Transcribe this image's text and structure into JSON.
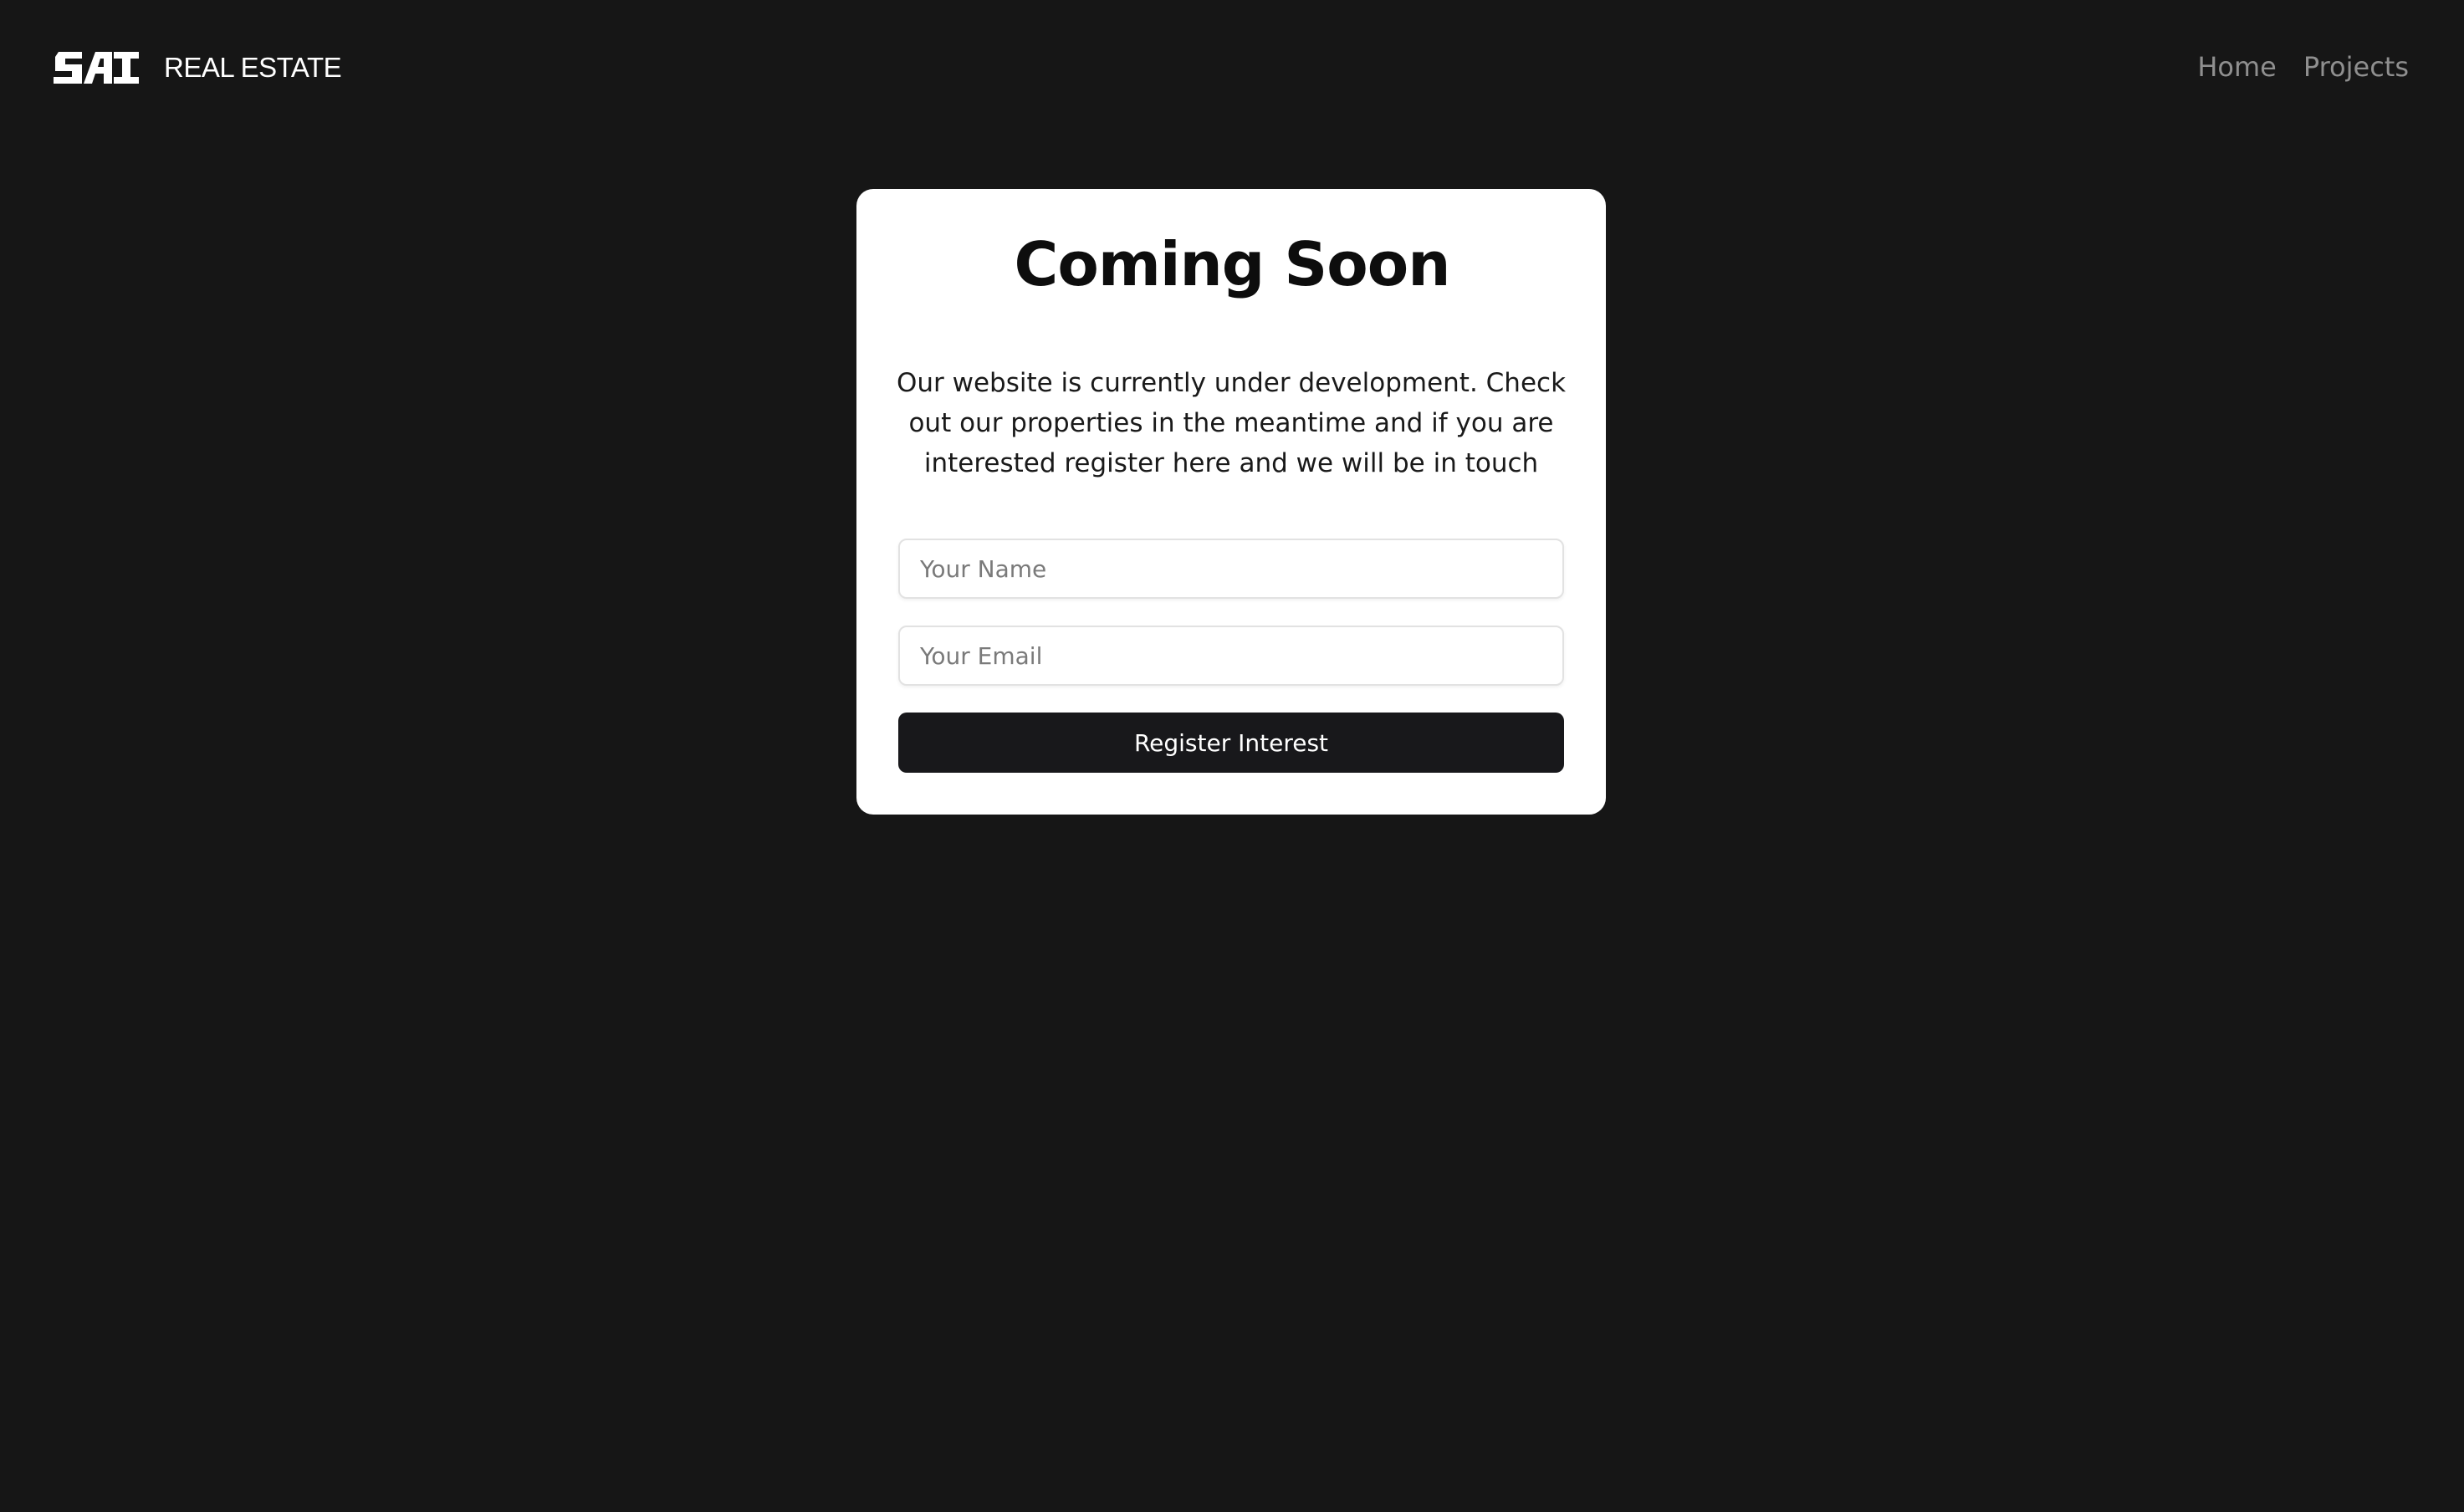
{
  "nav": {
    "logo_text": "SAI",
    "brand_name": "REAL ESTATE",
    "links": [
      {
        "label": "Home"
      },
      {
        "label": "Projects"
      }
    ]
  },
  "colors": {
    "background": "#161616",
    "card": "#ffffff",
    "button": "#18181b",
    "nav_link": "#8f8f8f"
  },
  "card": {
    "title": "Coming Soon",
    "description": "Our website is currently under development. Check out our properties in the meantime and if you are interested register here and we will be in touch",
    "name_placeholder": "Your Name",
    "email_placeholder": "Your Email",
    "button_label": "Register Interest"
  }
}
